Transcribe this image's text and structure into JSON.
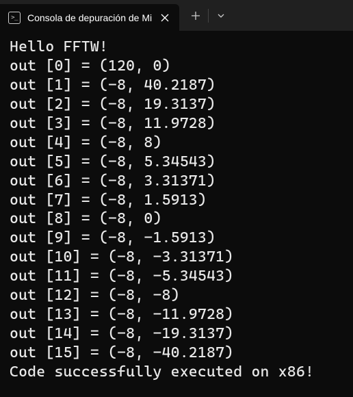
{
  "titlebar": {
    "tab": {
      "icon_label": "terminal-icon",
      "title": "Consola de depuración de Mi"
    },
    "new_tab_label": "+",
    "dropdown_label": "v"
  },
  "terminal": {
    "greeting": "Hello FFTW!",
    "outputs": [
      {
        "index": 0,
        "re": "120",
        "im": "0"
      },
      {
        "index": 1,
        "re": "-8",
        "im": "40.2187"
      },
      {
        "index": 2,
        "re": "-8",
        "im": "19.3137"
      },
      {
        "index": 3,
        "re": "-8",
        "im": "11.9728"
      },
      {
        "index": 4,
        "re": "-8",
        "im": "8"
      },
      {
        "index": 5,
        "re": "-8",
        "im": "5.34543"
      },
      {
        "index": 6,
        "re": "-8",
        "im": "3.31371"
      },
      {
        "index": 7,
        "re": "-8",
        "im": "1.5913"
      },
      {
        "index": 8,
        "re": "-8",
        "im": "0"
      },
      {
        "index": 9,
        "re": "-8",
        "im": "-1.5913"
      },
      {
        "index": 10,
        "re": "-8",
        "im": "-3.31371"
      },
      {
        "index": 11,
        "re": "-8",
        "im": "-5.34543"
      },
      {
        "index": 12,
        "re": "-8",
        "im": "-8"
      },
      {
        "index": 13,
        "re": "-8",
        "im": "-11.9728"
      },
      {
        "index": 14,
        "re": "-8",
        "im": "-19.3137"
      },
      {
        "index": 15,
        "re": "-8",
        "im": "-40.2187"
      }
    ],
    "final_message": "Code successfully executed on x86!"
  }
}
